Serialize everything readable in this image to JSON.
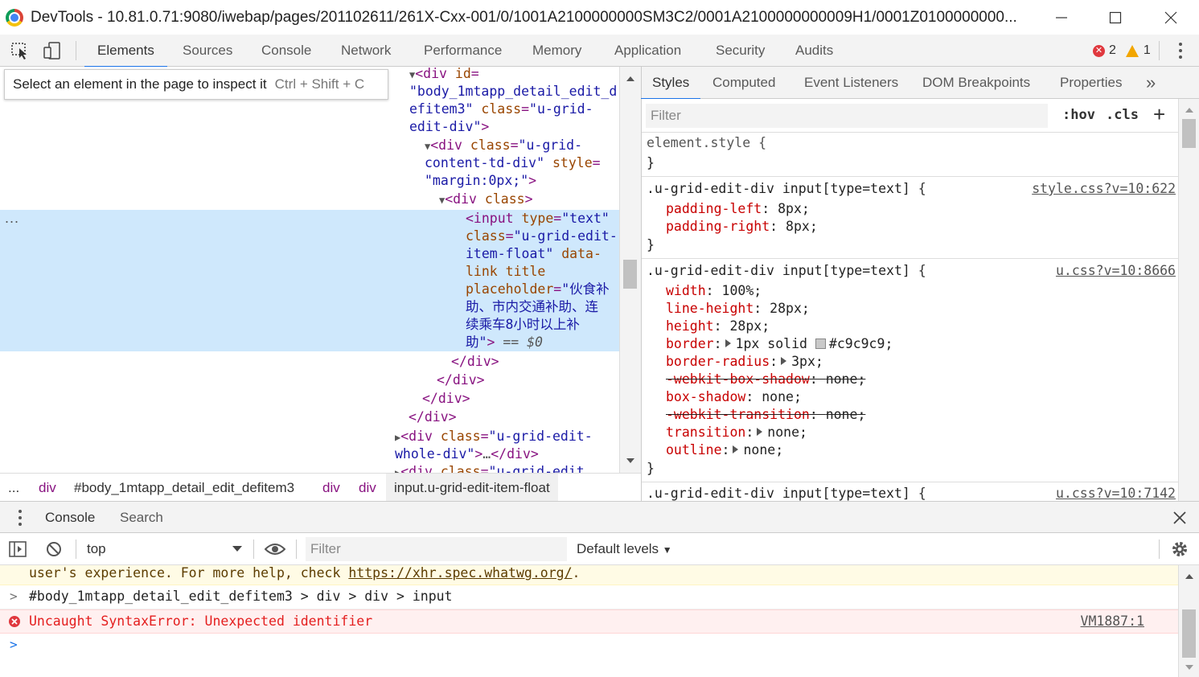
{
  "window": {
    "title": "DevTools - 10.81.0.71:9080/iwebap/pages/201102611/261X-Cxx-001/0/1001A2100000000SM3C2/0001A2100000000009H1/0001Z0100000000...",
    "minimize": "—",
    "maximize": "☐",
    "close": "✕"
  },
  "toolbar": {
    "tabs": [
      "Elements",
      "Sources",
      "Console",
      "Network",
      "Performance",
      "Memory",
      "Application",
      "Security",
      "Audits"
    ],
    "active_tab": "Elements",
    "error_count": "2",
    "warning_count": "1"
  },
  "inspect_tooltip": {
    "text": "Select an element in the page to inspect it",
    "shortcut": "Ctrl + Shift + C"
  },
  "dom_tree": {
    "ellipsis": "...",
    "selected_suffix": "== $0"
  },
  "breadcrumbs": [
    "...",
    "div",
    "#body_1mtapp_detail_edit_defitem3",
    "div",
    "div",
    "input.u-grid-edit-item-float"
  ],
  "styles_pane": {
    "tabs": [
      "Styles",
      "Computed",
      "Event Listeners",
      "DOM Breakpoints",
      "Properties"
    ],
    "more": "»",
    "filter_placeholder": "Filter",
    "hov": ":hov",
    "cls": ".cls",
    "add": "+",
    "element_style": "element.style {",
    "rules": [
      {
        "selector": ".u-grid-edit-div input[type=text]",
        "source": "style.css?v=10:622",
        "props": [
          {
            "name": "padding-left",
            "value": "8px",
            "struck": false
          },
          {
            "name": "padding-right",
            "value": "8px",
            "struck": false
          }
        ]
      },
      {
        "selector": ".u-grid-edit-div input[type=text]",
        "source": "u.css?v=10:8666",
        "props": [
          {
            "name": "width",
            "value": "100%",
            "struck": false
          },
          {
            "name": "line-height",
            "value": "28px",
            "struck": false
          },
          {
            "name": "height",
            "value": "28px",
            "struck": false
          },
          {
            "name": "border",
            "value": "1px solid #c9c9c9",
            "struck": false
          },
          {
            "name": "border-radius",
            "value": "3px",
            "struck": false
          },
          {
            "name": "-webkit-box-shadow",
            "value": "none",
            "struck": true
          },
          {
            "name": "box-shadow",
            "value": "none",
            "struck": false
          },
          {
            "name": "-webkit-transition",
            "value": "none",
            "struck": true
          },
          {
            "name": "transition",
            "value": "none",
            "struck": false
          },
          {
            "name": "outline",
            "value": "none",
            "struck": false
          }
        ]
      },
      {
        "selector": ".u-grid-edit-div input[type=text]",
        "source": "u.css?v=10:7142",
        "props": []
      }
    ]
  },
  "drawer": {
    "tabs": [
      "Console",
      "Search"
    ],
    "active_tab": "Console",
    "context": "top",
    "filter_placeholder": "Filter",
    "levels": "Default levels"
  },
  "console": {
    "warning_text": "user's experience. For more help, check ",
    "warning_link": "https://xhr.spec.whatwg.org/",
    "warning_tail": ".",
    "command": "#body_1mtapp_detail_edit_defitem3 > div > div > input",
    "error_text": "Uncaught SyntaxError: Unexpected identifier",
    "error_source": "VM1887:1"
  },
  "colors": {
    "accent": "#1a73e8",
    "selection": "#cfe8fc",
    "error": "#e41e1e",
    "warning_bg": "#fffbe5",
    "error_bg": "#fff0f0"
  }
}
